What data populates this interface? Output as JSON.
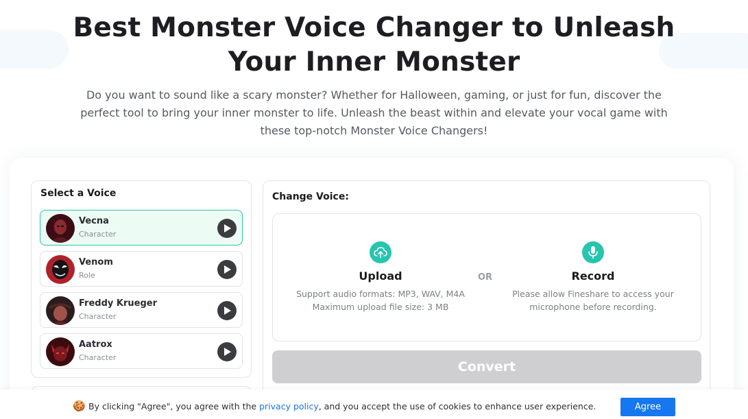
{
  "hero": {
    "title_line1": "Best Monster Voice Changer to Unleash",
    "title_line2": "Your Inner Monster",
    "description": "Do you want to sound like a scary monster? Whether for Halloween, gaming, or just for fun, discover the perfect tool to bring your inner monster to life. Unleash the beast within and elevate your vocal game with these top-notch Monster Voice Changers!"
  },
  "voice_panel": {
    "title": "Select a Voice",
    "items": [
      {
        "name": "Vecna",
        "type": "Character",
        "selected": true,
        "avatar_color": "#7a1f2a"
      },
      {
        "name": "Venom",
        "type": "Role",
        "selected": false,
        "avatar_color": "#1c1c28"
      },
      {
        "name": "Freddy Krueger",
        "type": "Character",
        "selected": false,
        "avatar_color": "#5a2a2a"
      },
      {
        "name": "Aatrox",
        "type": "Character",
        "selected": false,
        "avatar_color": "#8a1a1a"
      }
    ]
  },
  "change_panel": {
    "title": "Change Voice:",
    "upload": {
      "icon": "cloud-upload-icon",
      "title": "Upload",
      "desc_line1": "Support audio formats: MP3, WAV, M4A",
      "desc_line2": "Maximum upload file size: 3 MB"
    },
    "or_label": "OR",
    "record": {
      "icon": "microphone-icon",
      "title": "Record",
      "desc_line1": "Please allow Fineshare to access your",
      "desc_line2": "microphone before recording."
    },
    "convert_label": "Convert"
  },
  "cookie": {
    "icon": "cookie-icon",
    "text_before": "By clicking \"Agree\", you agree with the ",
    "link_text": "privacy policy",
    "text_after": ", and you accept the use of cookies to enhance user experience.",
    "agree_label": "Agree"
  },
  "colors": {
    "accent": "#27c4ae",
    "selected_bg": "#edfbf5",
    "convert_disabled": "#cfcfd1",
    "agree_blue": "#1677f0"
  }
}
